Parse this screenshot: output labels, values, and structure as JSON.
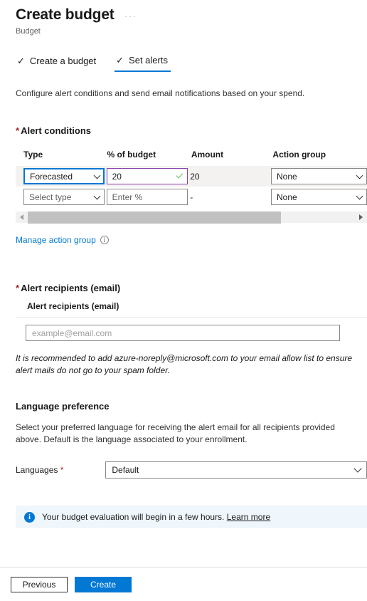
{
  "header": {
    "title": "Create budget",
    "subtitle": "Budget",
    "more_label": "···"
  },
  "tabs": [
    {
      "label": "Create a budget",
      "check": "✓",
      "active": false
    },
    {
      "label": "Set alerts",
      "check": "✓",
      "active": true
    }
  ],
  "description": "Configure alert conditions and send email notifications based on your spend.",
  "alert_conditions": {
    "section_label": "Alert conditions",
    "required_mark": "*",
    "columns": [
      "Type",
      "% of budget",
      "Amount",
      "Action group"
    ],
    "rows": [
      {
        "type": "Forecasted",
        "percent": "20",
        "amount": "20",
        "action_group": "None",
        "type_focused": true,
        "percent_valid": true
      },
      {
        "type": "Select type",
        "percent": "Enter %",
        "amount": "-",
        "action_group": "None",
        "type_focused": false,
        "percent_valid": false
      }
    ],
    "manage_link": "Manage action group",
    "info_glyph": "i"
  },
  "alert_recipients": {
    "section_label": "Alert recipients (email)",
    "required_mark": "*",
    "field_label": "Alert recipients (email)",
    "placeholder": "example@email.com",
    "value": "",
    "note": "It is recommended to add azure-noreply@microsoft.com to your email allow list to ensure alert mails do not go to your spam folder."
  },
  "language_preference": {
    "title": "Language preference",
    "description": "Select your preferred language for receiving the alert email for all recipients provided above. Default is the language associated to your enrollment.",
    "field_label": "Languages",
    "required_mark": "*",
    "selected": "Default"
  },
  "banner": {
    "icon": "i",
    "text": "Your budget evaluation will begin in a few hours.",
    "link": "Learn more"
  },
  "footer": {
    "previous_label": "Previous",
    "create_label": "Create"
  },
  "colors": {
    "accent": "#0078d4",
    "required": "#a4262c",
    "valid_border": "#8a3faf",
    "valid_check": "#5db85c",
    "banner_bg": "#eff6fc",
    "row_alt_bg": "#f3f2f1"
  }
}
